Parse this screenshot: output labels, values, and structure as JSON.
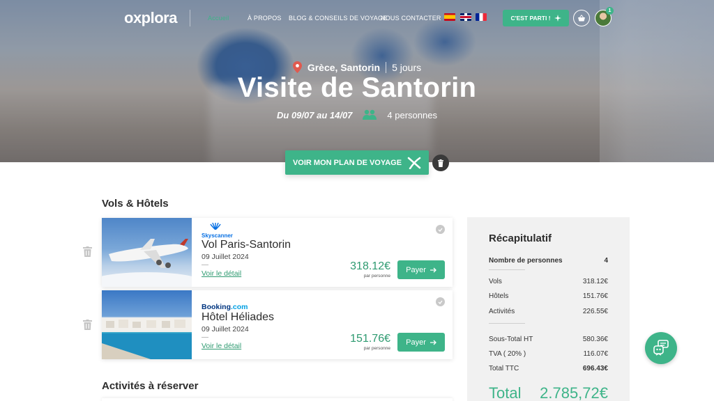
{
  "nav": {
    "logo": "oxplora",
    "links": [
      "Accueil",
      "À PROPOS",
      "BLOG & CONSEILS DE VOYAGE",
      "NOUS CONTACTER"
    ],
    "cta_label": "C'EST PARTI !",
    "cart_count": "1"
  },
  "hero": {
    "place": "Grèce, Santorin",
    "duration": "5 jours",
    "title": "Visite de Santorin",
    "dates": "Du 09/07 au 14/07",
    "people": "4 personnes",
    "plan_button": "VOIR MON PLAN DE VOYAGE"
  },
  "sections": {
    "flights_hotels": "Vols & Hôtels",
    "activities": "Activités à réserver"
  },
  "cards": [
    {
      "brand": "Skyscanner",
      "title": "Vol Paris-Santorin",
      "date": "09 Juillet 2024",
      "link": "Voir le détail",
      "price": "318.12€",
      "per": "par personne",
      "pay": "Payer"
    },
    {
      "brand_main": "Booking",
      "brand_suffix": ".com",
      "title": "Hôtel Héliades",
      "date": "09 Juillet 2024",
      "link": "Voir le détail",
      "price": "151.76€",
      "per": "par personne",
      "pay": "Payer"
    }
  ],
  "summary": {
    "title": "Récapitulatif",
    "people_label": "Nombre de personnes",
    "people_value": "4",
    "rows1": [
      {
        "label": "Vols",
        "value": "318.12€"
      },
      {
        "label": "Hôtels",
        "value": "151.76€"
      },
      {
        "label": "Activités",
        "value": "226.55€"
      }
    ],
    "rows2": [
      {
        "label": "Sous-Total HT",
        "value": "580.36€"
      },
      {
        "label": "TVA ( 20% )",
        "value": "116.07€"
      },
      {
        "label": "Total TTC",
        "value": "696.43€"
      }
    ],
    "total_label": "Total",
    "total_value": "2.785,72€"
  },
  "colors": {
    "accent": "#3eb489",
    "link": "#2e9a70",
    "summary_bg": "#f1f1f1"
  }
}
